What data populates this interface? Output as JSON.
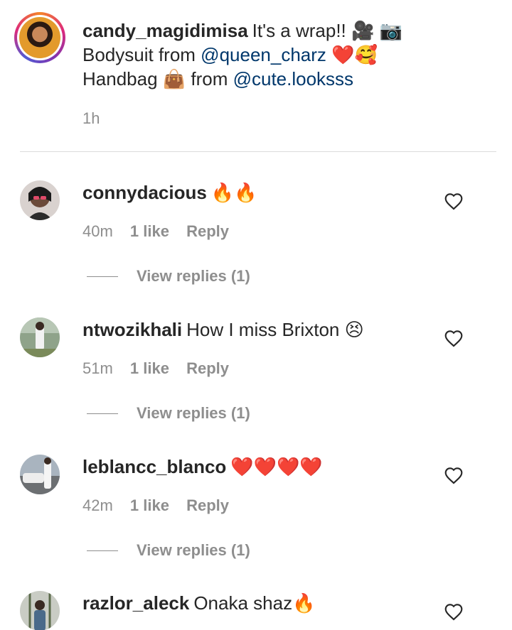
{
  "caption": {
    "username": "candy_magidimisa",
    "line1_text": "It's a wrap!! 🎥 📷",
    "line2_prefix": "Bodysuit from ",
    "line2_mention": "@queen_charz",
    "line2_suffix": " ❤️🥰",
    "line3_prefix": "Handbag 👜 from ",
    "line3_mention": "@cute.looksss",
    "time": "1h"
  },
  "comments": [
    {
      "username": "connydacious",
      "text": "🔥🔥",
      "time": "40m",
      "likes": "1 like",
      "reply": "Reply",
      "view_replies": "View replies (1)"
    },
    {
      "username": "ntwozikhali",
      "text": "How I miss Brixton 😣",
      "time": "51m",
      "likes": "1 like",
      "reply": "Reply",
      "view_replies": "View replies (1)"
    },
    {
      "username": "leblancc_blanco",
      "text": "❤️❤️❤️❤️",
      "time": "42m",
      "likes": "1 like",
      "reply": "Reply",
      "view_replies": "View replies (1)"
    },
    {
      "username": "razlor_aleck",
      "text": "Onaka shaz🔥",
      "time": "",
      "likes": "",
      "reply": "",
      "view_replies": ""
    }
  ],
  "icons": {
    "like": "heart-outline-icon"
  },
  "colors": {
    "text": "#262626",
    "secondary": "#8e8e8e",
    "mention": "#00376b",
    "divider": "#dbdbdb"
  }
}
